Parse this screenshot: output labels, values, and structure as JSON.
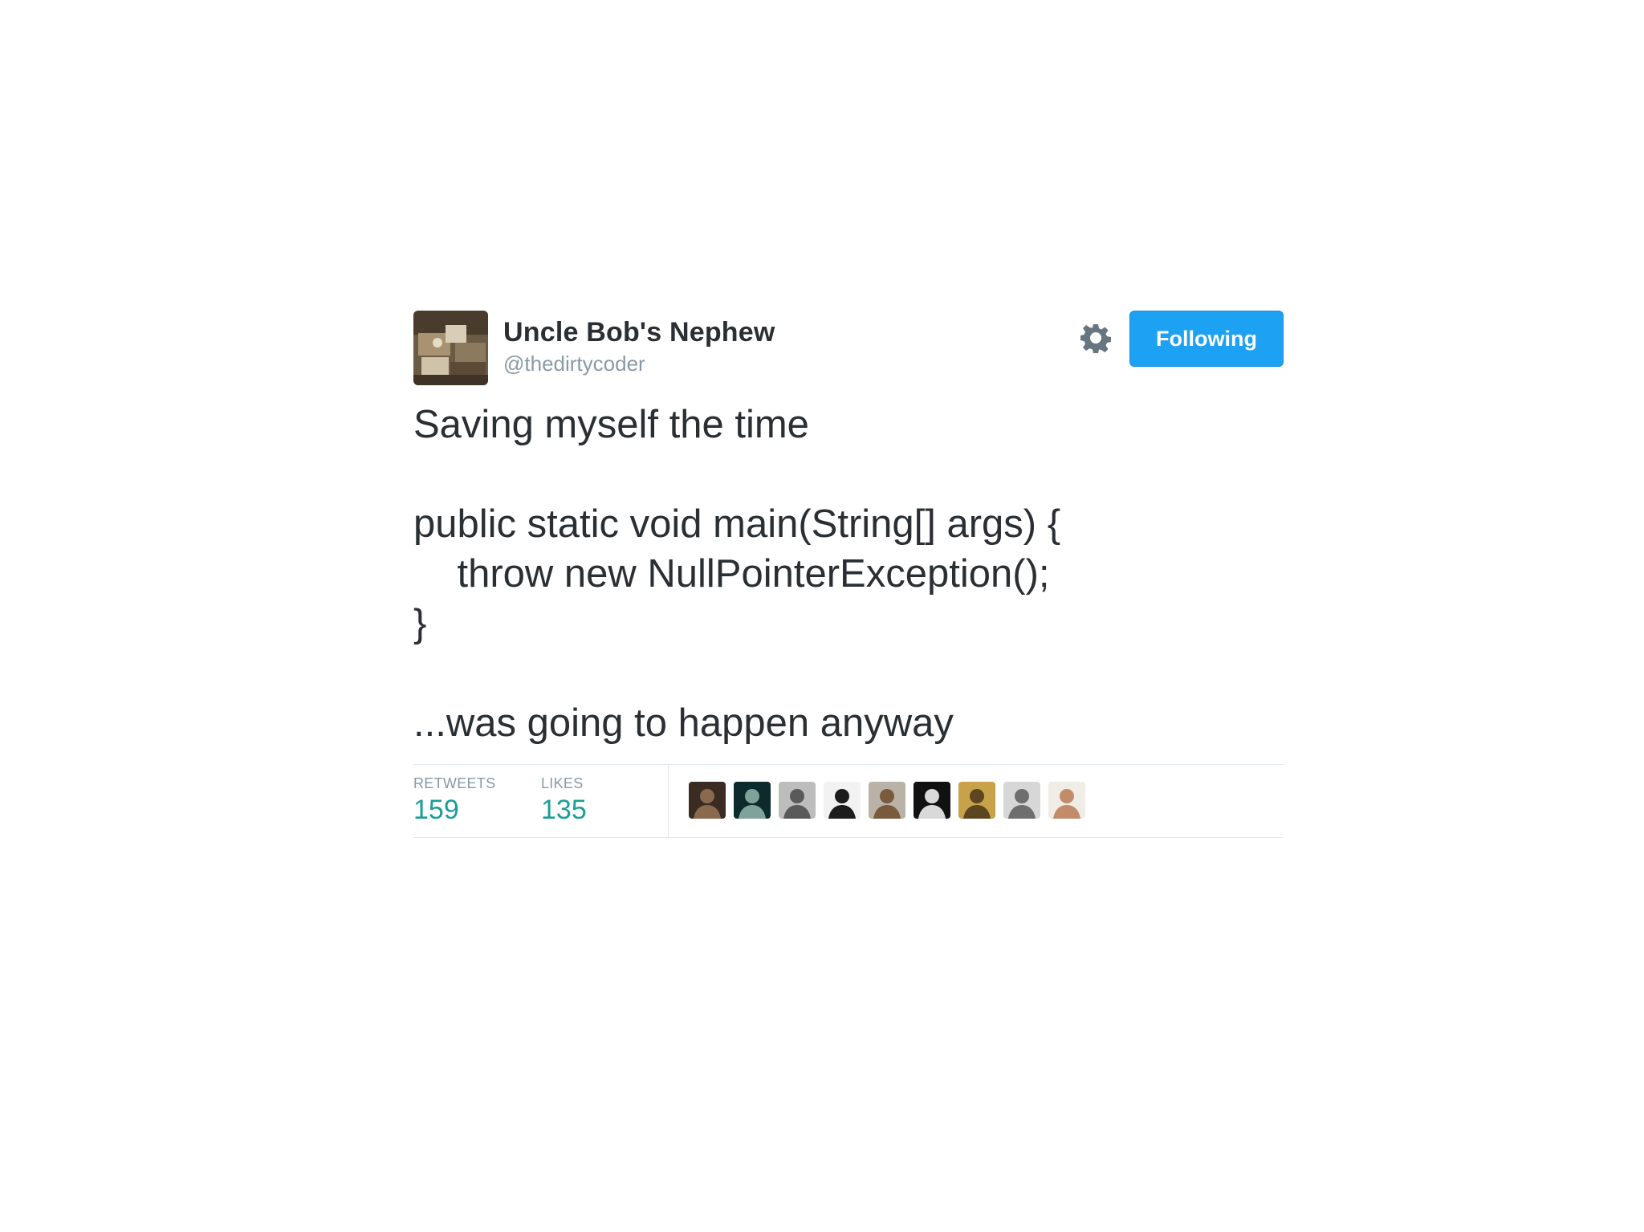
{
  "tweet": {
    "author": {
      "display_name": "Uncle Bob's Nephew",
      "handle": "@thedirtycoder",
      "avatar_icon": "user-avatar-photo"
    },
    "follow_button_label": "Following",
    "settings_icon": "gear-icon",
    "text_lines": [
      "Saving myself the time",
      "",
      "public static void main(String[] args) {",
      "    throw new NullPointerException();",
      "}",
      "",
      "...was going to happen anyway"
    ],
    "stats": {
      "retweets_label": "RETWEETS",
      "retweets_count": "159",
      "likes_label": "LIKES",
      "likes_count": "135"
    },
    "liker_avatars": [
      {
        "icon": "liker-avatar-photo",
        "colors": [
          "#3a2c22",
          "#8a6a4f"
        ]
      },
      {
        "icon": "liker-avatar-photo",
        "colors": [
          "#0d2b2b",
          "#7fa39a"
        ]
      },
      {
        "icon": "liker-avatar-photo",
        "colors": [
          "#bdbdbd",
          "#5a5a5a"
        ]
      },
      {
        "icon": "liker-avatar-photo",
        "colors": [
          "#f2f2f2",
          "#1c1c1c"
        ]
      },
      {
        "icon": "liker-avatar-photo",
        "colors": [
          "#b9b2a6",
          "#7a5a3c"
        ]
      },
      {
        "icon": "liker-avatar-photo",
        "colors": [
          "#111111",
          "#d9d9d9"
        ]
      },
      {
        "icon": "liker-avatar-photo",
        "colors": [
          "#c8a24a",
          "#5b4620"
        ]
      },
      {
        "icon": "liker-avatar-photo",
        "colors": [
          "#d7d7d7",
          "#6e6e6e"
        ]
      },
      {
        "icon": "liker-avatar-photo",
        "colors": [
          "#f0ece6",
          "#c28b6a"
        ]
      }
    ],
    "colors": {
      "follow_button_bg": "#1da1f2",
      "stat_value": "#1b9e96",
      "text": "#292f33",
      "muted": "#8899a6"
    }
  }
}
